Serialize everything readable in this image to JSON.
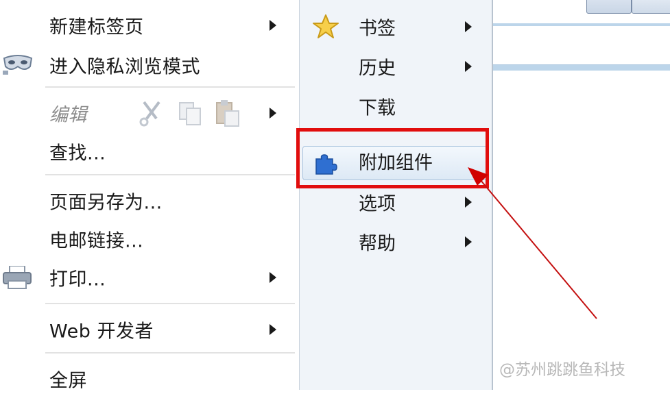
{
  "left_menu": {
    "items": [
      {
        "label": "新建标签页",
        "has_submenu": true
      },
      {
        "label": "进入隐私浏览模式",
        "icon": "mask-icon"
      },
      {
        "label": "编辑",
        "disabled": true,
        "has_submenu": true,
        "icons": [
          "cut-icon",
          "copy-icon",
          "paste-icon"
        ]
      },
      {
        "label": "查找..."
      },
      {
        "label": "页面另存为..."
      },
      {
        "label": "电邮链接..."
      },
      {
        "label": "打印...",
        "icon": "printer-icon",
        "has_submenu": true
      },
      {
        "label": "Web 开发者",
        "has_submenu": true
      },
      {
        "label": "全屏"
      }
    ]
  },
  "right_menu": {
    "items": [
      {
        "label": "书签",
        "icon": "star-icon",
        "has_submenu": true
      },
      {
        "label": "历史",
        "has_submenu": true
      },
      {
        "label": "下载"
      },
      {
        "label": "附加组件",
        "icon": "puzzle-icon",
        "highlighted": true
      },
      {
        "label": "选项",
        "has_submenu": true
      },
      {
        "label": "帮助",
        "has_submenu": true
      }
    ]
  },
  "annotation": {
    "box_color": "#e10d0d",
    "arrow_color": "#d00000"
  },
  "watermark": "@苏州跳跳鱼科技"
}
